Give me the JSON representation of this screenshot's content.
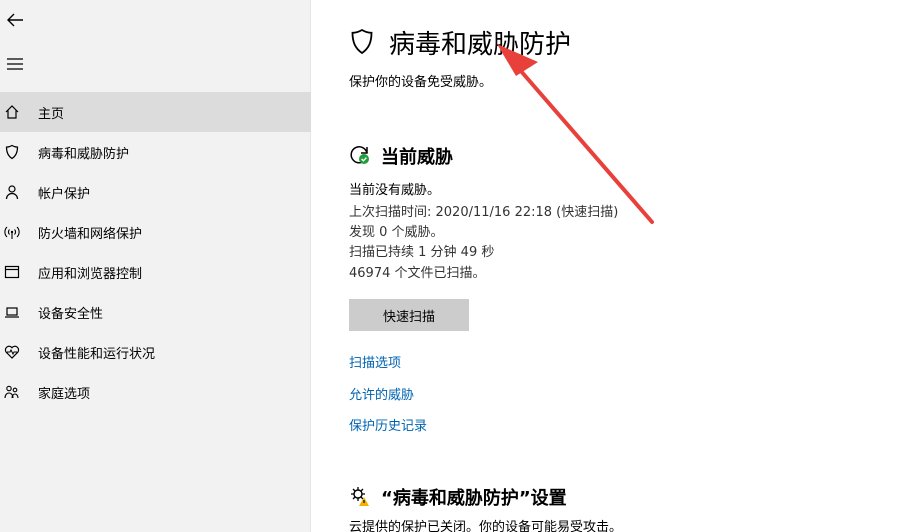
{
  "sidebar": {
    "back_icon": "back-arrow-icon",
    "menu_icon": "hamburger-menu-icon",
    "items": [
      {
        "label": "主页",
        "icon": "home-icon",
        "active": true
      },
      {
        "label": "病毒和威胁防护",
        "icon": "shield-icon"
      },
      {
        "label": "帐户保护",
        "icon": "person-icon"
      },
      {
        "label": "防火墙和网络保护",
        "icon": "wifi-signal-icon"
      },
      {
        "label": "应用和浏览器控制",
        "icon": "browser-window-icon"
      },
      {
        "label": "设备安全性",
        "icon": "laptop-icon"
      },
      {
        "label": "设备性能和运行状况",
        "icon": "heart-pulse-icon"
      },
      {
        "label": "家庭选项",
        "icon": "family-icon"
      }
    ]
  },
  "main": {
    "title": "病毒和威胁防护",
    "subtitle": "保护你的设备免受威胁。",
    "current_threats": {
      "title": "当前威胁",
      "status": "当前没有威胁。",
      "last_scan": "上次扫描时间: 2020/11/16 22:18 (快速扫描)",
      "found": "发现 0 个威胁。",
      "duration": "扫描已持续 1 分钟 49 秒",
      "files": "46974 个文件已扫描。",
      "button": "快速扫描",
      "links": [
        "扫描选项",
        "允许的威胁",
        "保护历史记录"
      ]
    },
    "settings": {
      "title": "“病毒和威胁防护”设置",
      "message": "云提供的保护已关闭。你的设备可能易受攻击。"
    }
  },
  "colors": {
    "sidebar_bg": "#f2f2f2",
    "active_bg": "#dcdcdc",
    "link": "#0063b1",
    "button_bg": "#cccccc",
    "annotation_arrow": "#e8403a",
    "ok_green": "#1f9e3a"
  }
}
